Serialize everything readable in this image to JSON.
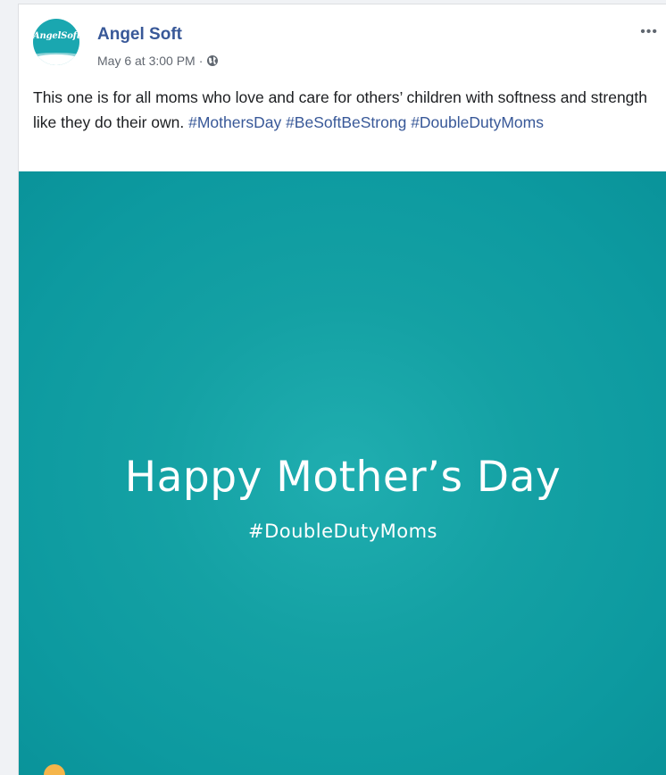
{
  "post": {
    "page_name": "Angel Soft",
    "avatar_text": "AngelSoft",
    "timestamp": "May 6 at 3:00 PM",
    "separator": "·",
    "privacy_icon": "globe-icon",
    "more_icon": "more-options-icon",
    "more_glyph": "•••",
    "body_text": "This one is for all moms who love and care for others’ children with softness and strength like they do their own. ",
    "hashtags": [
      "#MothersDay",
      "#BeSoftBeStrong",
      "#DoubleDutyMoms"
    ]
  },
  "image": {
    "headline": "Happy Mother’s Day",
    "subtag": "#DoubleDutyMoms",
    "background_color": "#109da2"
  }
}
